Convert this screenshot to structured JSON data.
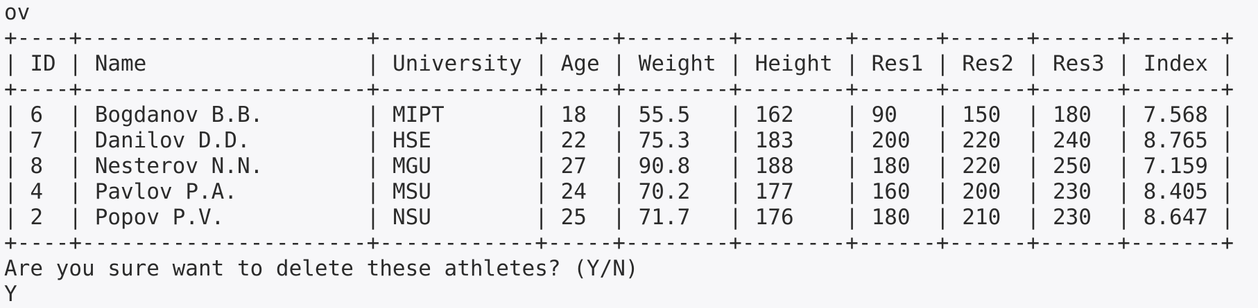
{
  "terminal": {
    "top_line": "ov",
    "table": {
      "widths": [
        4,
        22,
        12,
        5,
        8,
        8,
        6,
        6,
        6,
        7
      ],
      "headers": [
        "ID",
        "Name",
        "University",
        "Age",
        "Weight",
        "Height",
        "Res1",
        "Res2",
        "Res3",
        "Index"
      ],
      "rows": [
        [
          "6",
          "Bogdanov B.B.",
          "MIPT",
          "18",
          "55.5",
          "162",
          "90",
          "150",
          "180",
          "7.568"
        ],
        [
          "7",
          "Danilov D.D.",
          "HSE",
          "22",
          "75.3",
          "183",
          "200",
          "220",
          "240",
          "8.765"
        ],
        [
          "8",
          "Nesterov N.N.",
          "MGU",
          "27",
          "90.8",
          "188",
          "180",
          "220",
          "250",
          "7.159"
        ],
        [
          "4",
          "Pavlov P.A.",
          "MSU",
          "24",
          "70.2",
          "177",
          "160",
          "200",
          "230",
          "8.405"
        ],
        [
          "2",
          "Popov P.V.",
          "NSU",
          "25",
          "71.7",
          "176",
          "180",
          "210",
          "230",
          "8.647"
        ]
      ]
    },
    "prompt": "Are you sure want to delete these athletes? (Y/N)",
    "input": "Y"
  }
}
